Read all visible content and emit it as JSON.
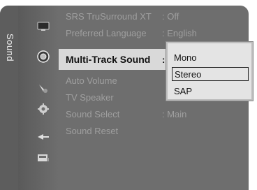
{
  "side_title": "Sound",
  "icons": [
    {
      "name": "picture-icon"
    },
    {
      "name": "sound-icon"
    },
    {
      "name": "channel-icon"
    },
    {
      "name": "setup-icon"
    },
    {
      "name": "input-icon"
    },
    {
      "name": "application-icon"
    }
  ],
  "menu": {
    "items": [
      {
        "label": "SRS TruSurround XT",
        "value": ": Off"
      },
      {
        "label": "Preferred Language",
        "value": ": English"
      },
      {
        "label": "Multi-Track Sound",
        "value": ":"
      },
      {
        "label": "Auto Volume",
        "value": ""
      },
      {
        "label": "TV Speaker",
        "value": ""
      },
      {
        "label": "Sound Select",
        "value": ": Main"
      },
      {
        "label": "Sound Reset",
        "value": ""
      }
    ]
  },
  "popup": {
    "options": [
      "Mono",
      "Stereo",
      "SAP"
    ],
    "selected": "Stereo"
  }
}
